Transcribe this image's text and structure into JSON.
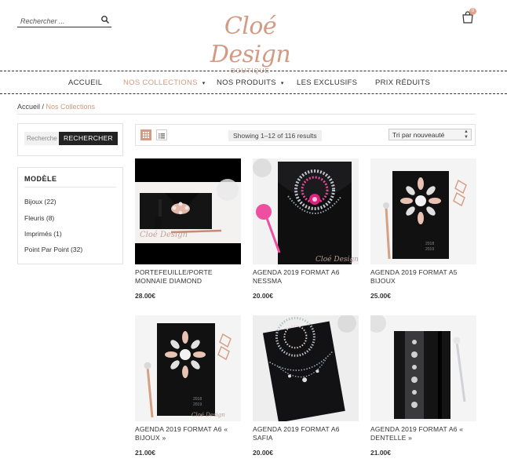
{
  "header": {
    "search_placeholder": "Rechercher ...",
    "logo_text": "Cloé Design",
    "logo_sub": "BOUTIQUE",
    "cart_count": "0"
  },
  "nav": {
    "items": [
      "ACCUEIL",
      "NOS COLLECTIONS",
      "NOS PRODUITS",
      "LES EXCLUSIFS",
      "PRIX RÉDUITS"
    ],
    "active": "NOS COLLECTIONS"
  },
  "breadcrumb": {
    "home": "Accueil",
    "separator": " / ",
    "current": "Nos Collections"
  },
  "sidebar": {
    "search_placeholder": "Recherche",
    "search_button": "RECHERCHER",
    "model_title": "MODÈLE",
    "categories": [
      "Bijoux (22)",
      "Fleuris (8)",
      "Imprimés (1)",
      "Point Par Point (32)"
    ]
  },
  "toolbar": {
    "result_count": "Showing 1–12 of 116 results",
    "orderby": "Tri par nouveauté"
  },
  "products": [
    {
      "title": "PORTEFEUILLE/PORTE MONNAIE DIAMOND",
      "price": "28.00€"
    },
    {
      "title": "AGENDA 2019 FORMAT A6 NESSMA",
      "price": "20.00€"
    },
    {
      "title": "AGENDA 2019 FORMAT A5 BIJOUX",
      "price": "25.00€"
    },
    {
      "title": "AGENDA 2019 FORMAT A6 « BIJOUX »",
      "price": "21.00€"
    },
    {
      "title": "AGENDA 2019 FORMAT A6 SAFIA",
      "price": "20.00€"
    },
    {
      "title": "AGENDA 2019 FORMAT A6 « DENTELLE »",
      "price": "21.00€"
    }
  ],
  "colors": {
    "accent": "#d39a80",
    "dark": "#232323"
  }
}
